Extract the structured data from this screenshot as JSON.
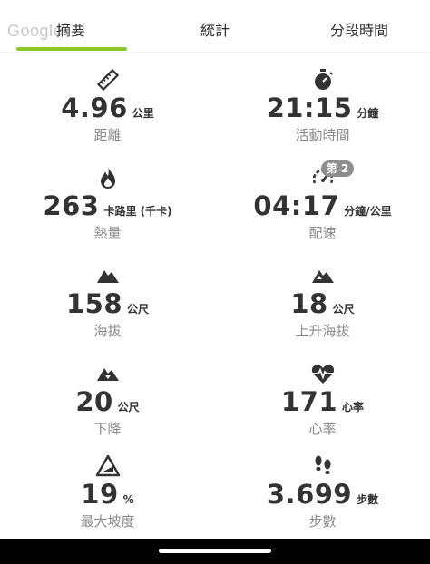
{
  "map": {
    "logo_text": "Google"
  },
  "tabs": [
    {
      "label": "摘要",
      "active": true
    },
    {
      "label": "統計",
      "active": false
    },
    {
      "label": "分段時間",
      "active": false
    }
  ],
  "accent_color": "#8bc926",
  "stats": [
    {
      "icon": "ruler-icon",
      "value": "4.96",
      "unit": "公里",
      "label": "距離"
    },
    {
      "icon": "stopwatch-icon",
      "value": "21:15",
      "unit": "分鐘",
      "label": "活動時間"
    },
    {
      "icon": "flame-icon",
      "value": "263",
      "unit": "卡路里 (千卡)",
      "label": "熱量"
    },
    {
      "icon": "pace-gauge-icon",
      "value": "04:17",
      "unit": "分鐘/公里",
      "label": "配速",
      "badge": "第 2"
    },
    {
      "icon": "mountain-icon",
      "value": "158",
      "unit": "公尺",
      "label": "海拔"
    },
    {
      "icon": "mountain-up-icon",
      "value": "18",
      "unit": "公尺",
      "label": "上升海拔"
    },
    {
      "icon": "mountain-down-icon",
      "value": "20",
      "unit": "公尺",
      "label": "下降"
    },
    {
      "icon": "heart-rate-icon",
      "value": "171",
      "unit": "心率",
      "label": "心率"
    },
    {
      "icon": "slope-icon",
      "value": "19",
      "unit": "%",
      "label": "最大坡度"
    },
    {
      "icon": "footsteps-icon",
      "value": "3.699",
      "unit": "步數",
      "label": "步數"
    }
  ]
}
